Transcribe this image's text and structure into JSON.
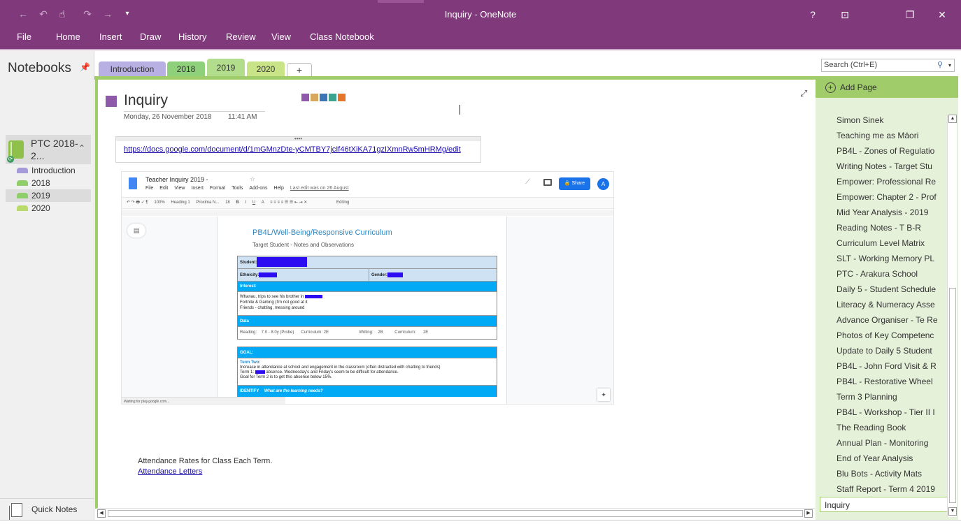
{
  "window": {
    "title": "Inquiry - OneNote",
    "help": "?",
    "restore_ribbon": "⊡",
    "restore": "❐",
    "close": "✕"
  },
  "quick_access": {
    "back": "←",
    "undo": "↶",
    "touch": "☝",
    "redo": "↷",
    "forward": "→",
    "customize": "▾"
  },
  "ribbon_tabs": [
    "File",
    "Home",
    "Insert",
    "Draw",
    "History",
    "Review",
    "View",
    "Class Notebook"
  ],
  "left_panel": {
    "header": "Notebooks",
    "notebook_name": "PTC 2018-2...",
    "sections": [
      {
        "label": "Introduction",
        "color": "#a59bd9"
      },
      {
        "label": "2018",
        "color": "#8fce6a"
      },
      {
        "label": "2019",
        "color": "#8fce6a"
      },
      {
        "label": "2020",
        "color": "#bada6c"
      }
    ],
    "quick_notes": "Quick Notes"
  },
  "section_tabs": [
    {
      "label": "Introduction",
      "color": "#b8b0e2"
    },
    {
      "label": "2018",
      "color": "#8fd07a"
    },
    {
      "label": "2019",
      "color": "#b2dd8c"
    },
    {
      "label": "2020",
      "color": "#c9e486"
    },
    {
      "label": "+",
      "color": "#ffffff"
    }
  ],
  "search": {
    "placeholder": "Search (Ctrl+E)"
  },
  "page": {
    "title": "Inquiry",
    "date": "Monday, 26 November 2018",
    "time": "11:41 AM",
    "link": "https://docs.google.com/document/d/1mGMnzDte-yCMTBY7jcIf46tXiKA71gzIXmnRw5mHRMg/edit",
    "bottom_text": "Attendance Rates for Class Each Term.",
    "bottom_link": "Attendance Letters",
    "swatch_colors": [
      "#8e59a8",
      "#d7a85b",
      "#3b75b6",
      "#3ca38f",
      "#e3762a"
    ]
  },
  "gdoc": {
    "title": "Teacher Inquiry 2019 -",
    "menu": [
      "File",
      "Edit",
      "View",
      "Insert",
      "Format",
      "Tools",
      "Add-ons",
      "Help"
    ],
    "last_edit": "Last edit was on 26 August",
    "share": "Share",
    "avatar": "A",
    "toolbar": [
      "100%",
      "Heading 1",
      "Proxima N...",
      "18",
      "B",
      "I",
      "U",
      "A",
      "Editing"
    ],
    "heading": "PB4L/Well-Being/Responsive Curriculum",
    "subheading": "Target Student - Notes and Observations",
    "student_label": "Student:",
    "ethnicity_label": "Ethnicity:",
    "gender_label": "Gender:",
    "interest_label": "Interest:",
    "interest_lines": [
      "Whanau, trips to see his brother in",
      "Fortnite & Gaming (I'm not good at it",
      "Friends - chatting, messing around"
    ],
    "data_label": "Data",
    "data_row": "Reading:    7.0 - 8.0y (Probe)      Curriculum: 2E                          Writing:    2B          Curriculum:      2E",
    "goal_label": "GOAL:",
    "term_two": "Term Two:",
    "goal_lines": [
      "Increase in attendance at school and engagement in the classroom (often distracted with chatting to friends)",
      "absence.    Wednesday's and Friday's seem to be difficult for attendance.",
      "Goal for Term 2 is to get this absence below 15%."
    ],
    "term1_prefix": "Term 1:",
    "identify_label": "IDENTIFY",
    "identify_q": "What are the learning needs?",
    "status": "Waiting for play.google.com..."
  },
  "right_panel": {
    "add_page": "Add Page",
    "pages": [
      "Simon Sinek",
      "Teaching me as Māori",
      "PB4L - Zones of Regulatio",
      "Writing Notes - Target Stu",
      "Empower: Professional Re",
      "Empower: Chapter 2 - Prof",
      "Mid Year Analysis - 2019",
      "Reading Notes - T B-R",
      "Curriculum Level Matrix",
      "SLT - Working Memory PL",
      "PTC - Arakura School",
      "Daily 5 - Student Schedule",
      "Literacy & Numeracy Asse",
      "Advance Organiser - Te Re",
      "Photos of Key Competenc",
      "Update to Daily 5 Student",
      "PB4L - John Ford Visit & R",
      "PB4L - Restorative Wheel",
      "Term 3 Planning",
      "PB4L - Workshop - Tier II I",
      "The Reading Book",
      "Annual Plan - Monitoring",
      "End of Year Analysis",
      "Blu Bots - Activity Mats",
      "Staff Report - Term 4 2019",
      "Inquiry"
    ]
  }
}
